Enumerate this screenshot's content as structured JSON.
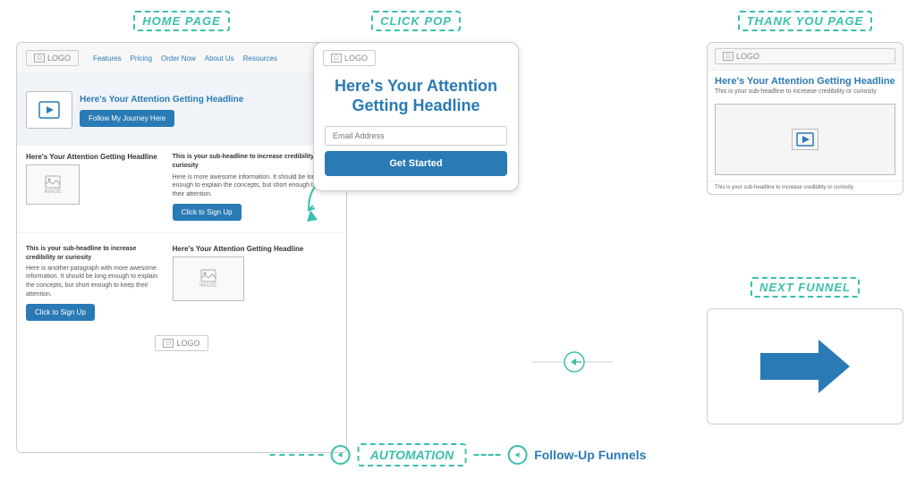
{
  "sections": {
    "home_page": {
      "label": "HOME PAGE",
      "logo_text": "LOGO",
      "nav_items": [
        "Features",
        "Pricing",
        "Order Now",
        "About Us",
        "Resources"
      ],
      "hero_headline": "Here's Your Attention Getting Headline",
      "cta_button": "Follow My Journey Here",
      "content_headline1": "Here's Your Attention Getting Headline",
      "image_label": "IMAGE",
      "text_block1": "This is your sub-headline to increase credibility or curiosity",
      "text_body1": "Here is more awesome information. It should be long enough to explain the concepts, but short enough to keep their attention.",
      "text_block2": "This is your sub-headline to increase credibility or curiosity",
      "text_body2": "Here is another paragraph with more awesome information. It should be long enough to explain the concepts, but short enough to keep their attention.",
      "cta_button2": "Click to Sign Up",
      "content_headline2": "Here's Your Attention Getting Headline",
      "image_label2": "IMAGE",
      "footer_logo": "LOGO"
    },
    "click_pop": {
      "label": "CLICK POP",
      "logo_text": "LOGO",
      "headline": "Here's Your Attention Getting Headline",
      "email_placeholder": "Email Address",
      "button_label": "Get Started"
    },
    "thank_you": {
      "label": "THANK YOU PAGE",
      "logo_text": "LOGO",
      "headline": "Here's Your Attention Getting Headline",
      "sub_headline": "This is your sub-headline to increase credibility or curiosity",
      "bottom_text": "This is your sub-headline to increase credibility or curiosity"
    },
    "next_funnel": {
      "label": "NEXT FUNNEL"
    },
    "automation": {
      "label": "AUTOMATION",
      "followup_label": "Follow-Up Funnels"
    }
  }
}
